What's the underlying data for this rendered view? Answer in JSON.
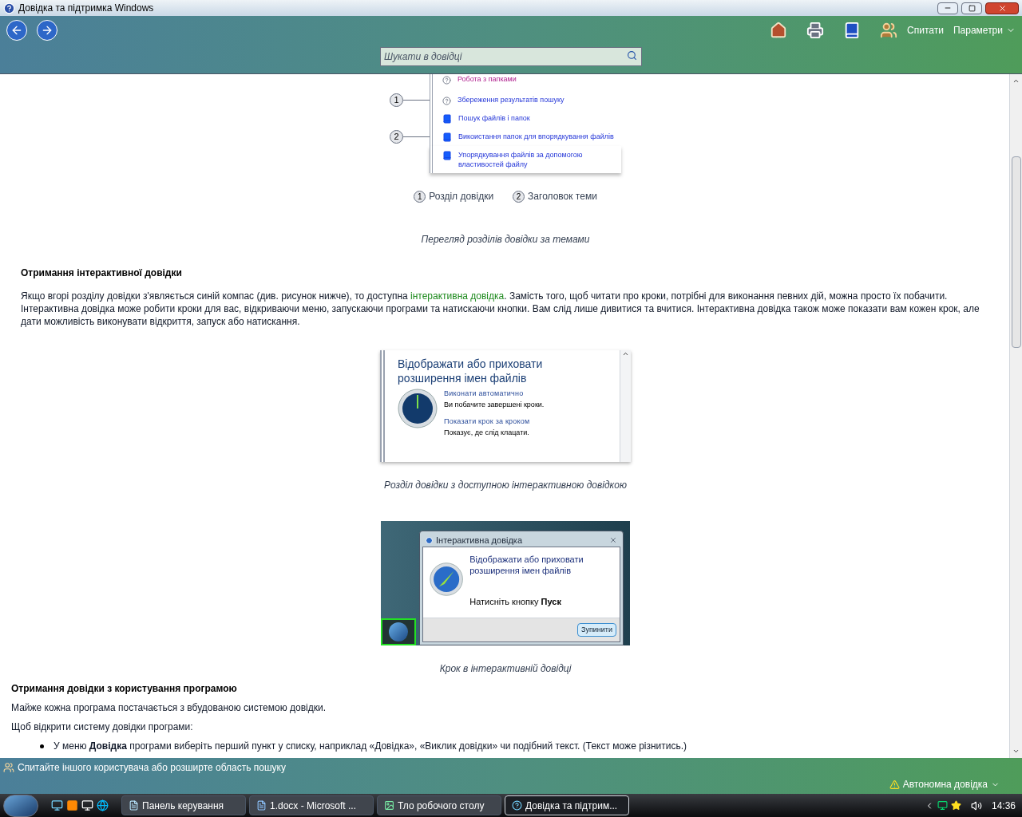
{
  "window": {
    "title": "Довідка та підтримка Windows"
  },
  "toolbar": {
    "buttons": [
      "Спитати",
      "Параметри"
    ],
    "search": {
      "placeholder": "Шукати в довідці"
    }
  },
  "figure_1": {
    "items": [
      {
        "text": "Робота з папками",
        "kind": "question",
        "visited": true
      },
      {
        "text": "Збереження результатів пошуку",
        "kind": "question",
        "visited": false,
        "callout": "1"
      },
      {
        "text": "Пошук файлів і папок",
        "kind": "book",
        "visited": false
      },
      {
        "text": "Викоистання папок для впорядкування файлів",
        "kind": "book",
        "visited": false,
        "callout": "2"
      },
      {
        "text": "Упорядкування файлів за допомогою властивостей файлу",
        "kind": "book",
        "visited": false
      }
    ],
    "legend": [
      {
        "number": "1",
        "label": "Розділ довідки"
      },
      {
        "number": "2",
        "label": "Заголовок теми"
      }
    ],
    "caption": "Перегляд розділів довідки за темами"
  },
  "section_1": {
    "heading": "Отримання інтерактивної довідки",
    "paragraph": {
      "before": "Якщо вгорі розділу довідки з'являється синій компас (див. рисунок нижче), то доступна ",
      "link": "інтерактивна довідка",
      "after": ". Замість того, щоб читати про кроки, потрібні для виконання певних дій, можна просто їх побачити. Інтерактивна довідка може робити кроки для вас, відкриваючи меню, запускаючи програми та натискаючи кнопки. Вам слід лише дивитися та вчитися. Інтерактивна довідка також може показати вам кожен крок, але дати можливість виконувати відкриття, запуск або натискання."
    }
  },
  "figure_2": {
    "title": "Відображати або приховати розширення імен файлів",
    "options": [
      {
        "title": "Виконати автоматично",
        "description": "Ви побачите завершені кроки."
      },
      {
        "title": "Показати крок за кроком",
        "description": "Показує, де слід клацати."
      }
    ],
    "caption": "Розділ довідки з доступною інтерактивною довідкою"
  },
  "figure_3": {
    "window_title": "Інтерактивна довідка",
    "heading": "Відображати або приховати розширення імен файлів",
    "instruction": "Натисніть кнопку **Пуск**",
    "button": "Зупинити",
    "caption": "Крок в інтерактивній довідці"
  },
  "section_2": {
    "heading": "Отримання довідки з користування програмою",
    "paragraphs": [
      "Майже кожна програма постачається з вбудованою системою довідки.",
      "Щоб відкрити систему довідки програми:"
    ],
    "bullets": [
      "У меню **Довідка** програми виберіть перший пункт у списку, наприклад «Довідка», «Виклик довідки» чи подібний текст. (Текст може різнитись.)"
    ]
  },
  "status_bar": {
    "message": "Спитайте іншого користувача або розширте область пошуку",
    "mode": "Автономна довідка"
  },
  "taskbar": {
    "tasks": [
      {
        "label": "Панель керування",
        "selected": false
      },
      {
        "label": "1.docx - Microsoft ...",
        "selected": false
      },
      {
        "label": "Тло робочого столу",
        "selected": false
      },
      {
        "label": "Довідка та підтрим...",
        "selected": true
      }
    ],
    "clock": "14:36"
  }
}
